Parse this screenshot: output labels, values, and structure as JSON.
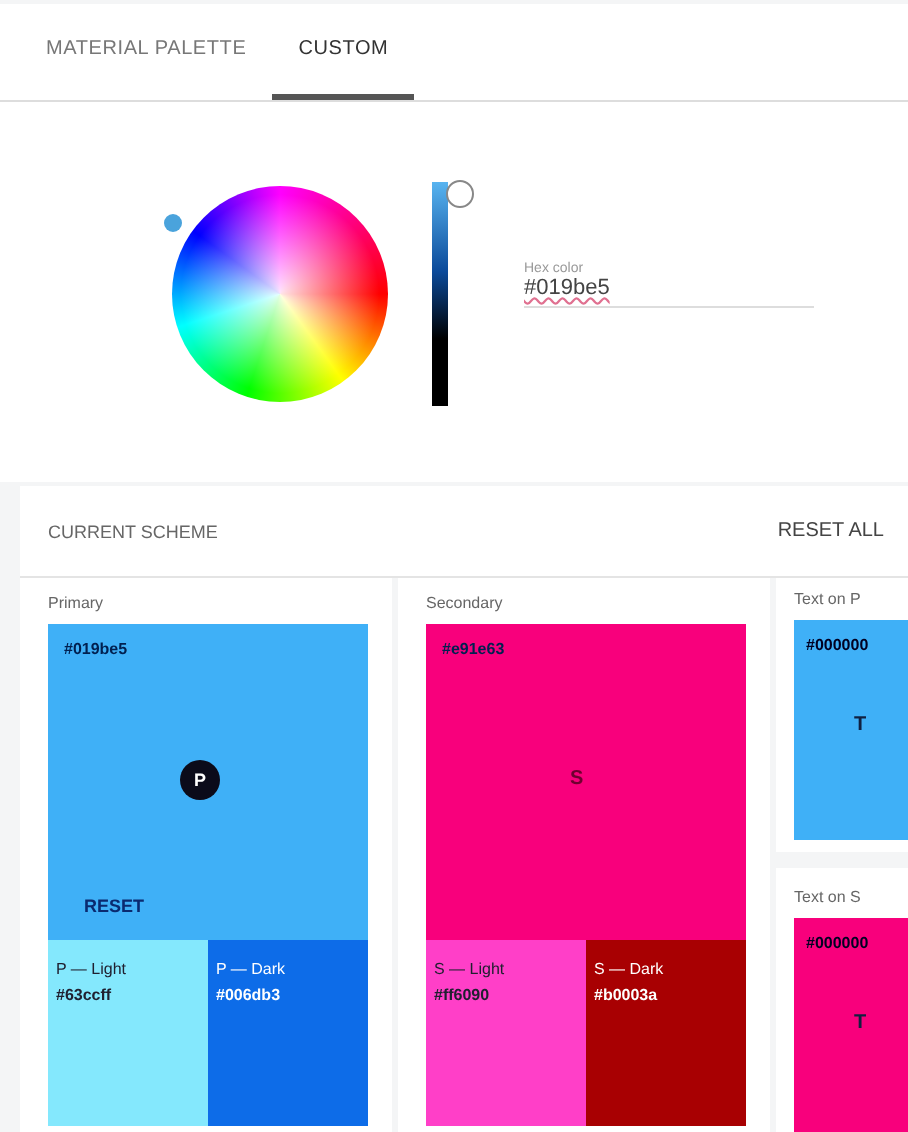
{
  "tabs": [
    {
      "label": "MATERIAL PALETTE",
      "selected": false
    },
    {
      "label": "CUSTOM",
      "selected": true
    }
  ],
  "picker": {
    "field_label": "Hex color",
    "value": "#019be5",
    "level": 1
  },
  "scheme": {
    "title": "CURRENT SCHEME",
    "reset_all": "RESET ALL"
  },
  "cards": [
    {
      "kind": "scheme",
      "title": "Primary",
      "main": {
        "hex": "#019be5",
        "color": "#3fb0f7",
        "letter": "P",
        "letter_circle": true,
        "reset": "RESET"
      },
      "light": {
        "label": "P — Light",
        "hex": "#63ccff",
        "color": "#84e8fd"
      },
      "dark": {
        "label": "P — Dark",
        "hex": "#006db3",
        "color": "#0d6ce8"
      }
    },
    {
      "kind": "scheme",
      "title": "Secondary",
      "main": {
        "hex": "#e91e63",
        "color": "#f8007c",
        "letter": "S",
        "letter_circle": false
      },
      "light": {
        "label": "S — Light",
        "hex": "#ff6090",
        "color": "#ff3fc8"
      },
      "dark": {
        "label": "S — Dark",
        "hex": "#b0003a",
        "color": "#a80002"
      }
    },
    {
      "kind": "text",
      "title": "Text on P",
      "hex": "#000000",
      "color": "#3fb0f7",
      "letter": "T"
    },
    {
      "kind": "text",
      "title": "Text on S",
      "hex": "#000000",
      "color": "#f8007c",
      "letter": "T"
    }
  ]
}
